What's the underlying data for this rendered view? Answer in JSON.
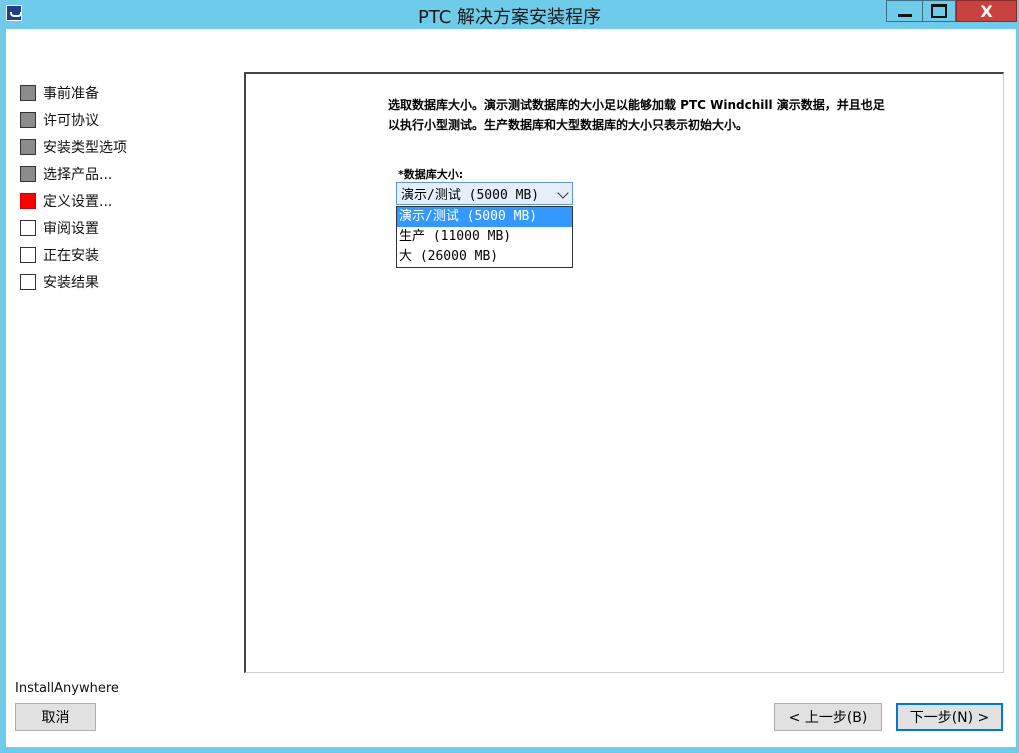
{
  "window": {
    "title": "PTC 解决方案安装程序",
    "close_glyph": "X",
    "icons": [
      "app-icon",
      "minimize-icon",
      "maximize-icon",
      "close-icon"
    ]
  },
  "steps": [
    {
      "label": "事前准备",
      "state": "done"
    },
    {
      "label": "许可协议",
      "state": "done"
    },
    {
      "label": "安装类型选项",
      "state": "done"
    },
    {
      "label": "选择产品...",
      "state": "done"
    },
    {
      "label": "定义设置...",
      "state": "current"
    },
    {
      "label": "审阅设置",
      "state": "todo"
    },
    {
      "label": "正在安装",
      "state": "todo"
    },
    {
      "label": "安装结果",
      "state": "todo"
    }
  ],
  "main": {
    "description": "选取数据库大小。演示测试数据库的大小足以能够加载 PTC Windchill 演示数据，并且也足以执行小型测试。生产数据库和大型数据库的大小只表示初始大小。",
    "db_size_label": "*数据库大小:",
    "db_size_selected": "演示/测试 (5000 MB)",
    "db_size_options": [
      "演示/测试 (5000 MB)",
      "生产 (11000 MB)",
      "大 (26000 MB)"
    ]
  },
  "footer": {
    "brand": "InstallAnywhere",
    "cancel_label": "取消",
    "prev_label": "< 上一步(B)",
    "next_label": "下一步(N) >"
  },
  "colors": {
    "titlebar": "#6ecbea",
    "close_button": "#c8413e",
    "step_done": "#8c8c8c",
    "step_current": "#ff0000",
    "option_highlight": "#3399ff"
  }
}
